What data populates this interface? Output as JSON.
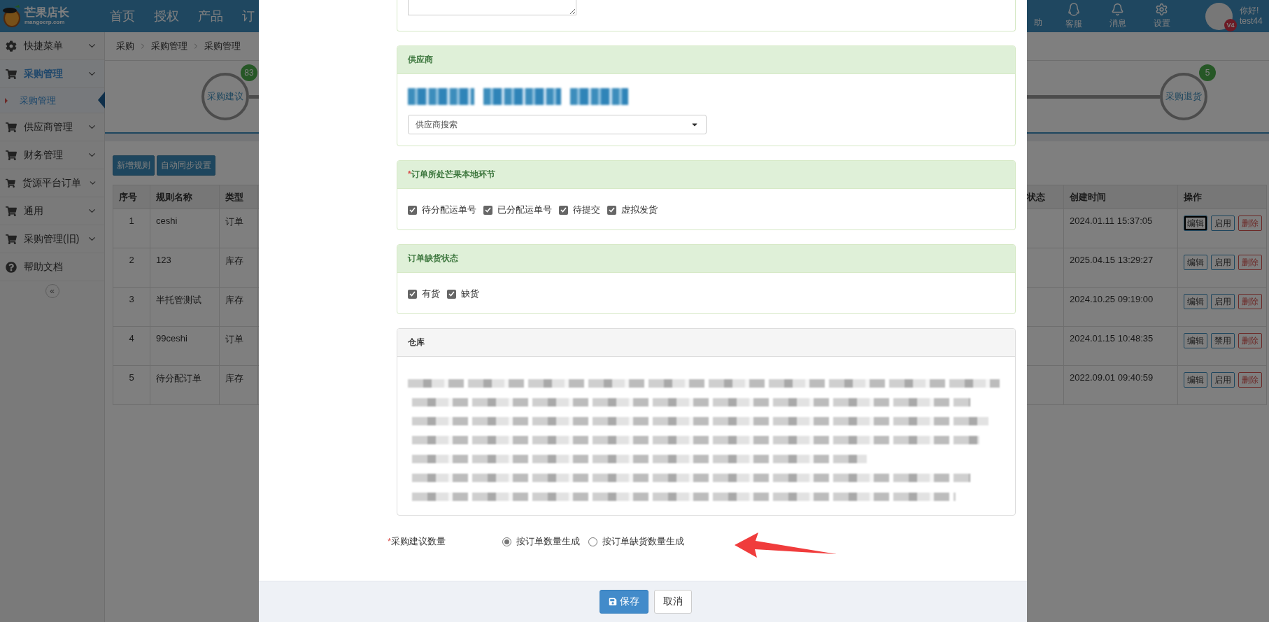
{
  "header": {
    "logo": {
      "title": "芒果店长",
      "subtitle": "mangoerp.com"
    },
    "nav": [
      "首页",
      "授权",
      "产品",
      "订"
    ],
    "tools": [
      {
        "label": "助",
        "kind": "help"
      },
      {
        "label": "客服",
        "kind": "service"
      },
      {
        "label": "消息",
        "kind": "bell"
      },
      {
        "label": "设置",
        "kind": "settings"
      }
    ],
    "user": {
      "badge": "V4",
      "greeting": "你好!",
      "name": "test44"
    }
  },
  "sidebar": {
    "items": [
      {
        "label": "快捷菜单",
        "kind": "quick",
        "selected": false
      },
      {
        "label": "采购管理",
        "kind": "module",
        "selected": true,
        "children": [
          {
            "label": "采购管理",
            "selected": true
          }
        ]
      },
      {
        "label": "供应商管理",
        "kind": "module",
        "selected": false
      },
      {
        "label": "财务管理",
        "kind": "module",
        "selected": false
      },
      {
        "label": "货源平台订单",
        "kind": "module",
        "selected": false
      },
      {
        "label": "通用",
        "kind": "module",
        "selected": false
      },
      {
        "label": "采购管理(旧)",
        "kind": "module",
        "selected": false
      },
      {
        "label": "帮助文档",
        "kind": "docs",
        "selected": false
      }
    ],
    "collapse": "«"
  },
  "breadcrumb": [
    "采购",
    "采购管理",
    "采购管理"
  ],
  "steps": [
    {
      "label": "采购建议",
      "count": "83"
    },
    {
      "label": "采购退货",
      "count": "5"
    }
  ],
  "toolbar": [
    "新增规则",
    "自动同步设置"
  ],
  "table": {
    "columns": [
      "序号",
      "规则名称",
      "类型",
      "状态",
      "创建时间",
      "操作"
    ],
    "rows": [
      {
        "index": "1",
        "name": "ceshi",
        "type": "订单",
        "created": "2024.01.11 15:37:05",
        "actions": [
          {
            "label": "编辑",
            "kind": "edit",
            "focused": true
          },
          {
            "label": "启用",
            "kind": "toggle",
            "focused": false
          },
          {
            "label": "删除",
            "kind": "delete",
            "focused": false
          }
        ]
      },
      {
        "index": "2",
        "name": "123",
        "type": "库存",
        "created": "2025.04.15 13:29:27",
        "actions": [
          {
            "label": "编辑",
            "kind": "edit",
            "focused": false
          },
          {
            "label": "启用",
            "kind": "toggle",
            "focused": false
          },
          {
            "label": "删除",
            "kind": "delete",
            "focused": false
          }
        ]
      },
      {
        "index": "3",
        "name": "半托管测试",
        "type": "库存",
        "created": "2024.10.25 09:19:00",
        "actions": [
          {
            "label": "编辑",
            "kind": "edit",
            "focused": false
          },
          {
            "label": "启用",
            "kind": "toggle",
            "focused": false
          },
          {
            "label": "删除",
            "kind": "delete",
            "focused": false
          }
        ]
      },
      {
        "index": "4",
        "name": "99ceshi",
        "type": "订单",
        "created": "2024.01.15 10:48:35",
        "actions": [
          {
            "label": "编辑",
            "kind": "edit",
            "focused": false
          },
          {
            "label": "禁用",
            "kind": "toggle",
            "focused": false
          },
          {
            "label": "删除",
            "kind": "delete",
            "focused": false
          }
        ]
      },
      {
        "index": "5",
        "name": "待分配订单",
        "type": "库存",
        "created": "2022.09.01 09:40:59",
        "actions": [
          {
            "label": "编辑",
            "kind": "edit",
            "focused": false
          },
          {
            "label": "启用",
            "kind": "toggle",
            "focused": false
          },
          {
            "label": "删除",
            "kind": "delete",
            "focused": false
          }
        ]
      }
    ]
  },
  "dialog": {
    "panels": [
      {
        "kind": "supplier",
        "title": "供应商",
        "select_placeholder": "供应商搜索"
      },
      {
        "kind": "checks",
        "marker": "*",
        "title": "订单所处芒果本地环节",
        "options": [
          {
            "label": "待分配运单号",
            "checked": true
          },
          {
            "label": "已分配运单号",
            "checked": true
          },
          {
            "label": "待提交",
            "checked": true
          },
          {
            "label": "虚拟发货",
            "checked": true
          }
        ]
      },
      {
        "kind": "checks",
        "title": "订单缺货状态",
        "options": [
          {
            "label": "有货",
            "checked": true
          },
          {
            "label": "缺货",
            "checked": true
          }
        ]
      },
      {
        "kind": "blurred",
        "title": "仓库"
      }
    ],
    "quantity": {
      "marker": "*",
      "label": "采购建议数量",
      "options": [
        {
          "label": "按订单数量生成",
          "selected": true
        },
        {
          "label": "按订单缺货数量生成",
          "selected": false
        }
      ]
    },
    "buttons": [
      {
        "label": "保存",
        "kind": "primary"
      },
      {
        "label": "取消",
        "kind": "default"
      }
    ]
  }
}
